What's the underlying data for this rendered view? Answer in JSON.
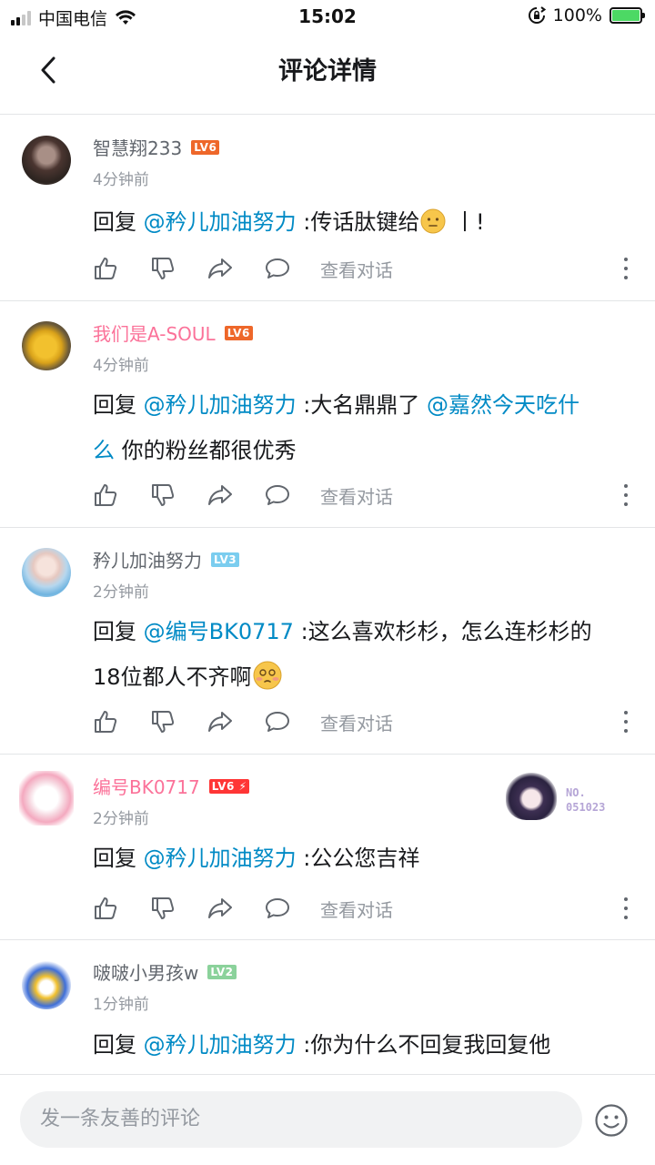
{
  "status_bar": {
    "carrier": "中国电信",
    "time": "15:02",
    "battery": "100%"
  },
  "header": {
    "title": "评论详情"
  },
  "labels": {
    "view_conversation": "查看对话"
  },
  "comments": [
    {
      "username": "智慧翔233",
      "level": "LV6",
      "time": "4分钟前",
      "reply_prefix": "回复",
      "mention": "@矜儿加油努力",
      "text": ":传话肽键给",
      "suffix": "丨!"
    },
    {
      "username": "我们是A-SOUL",
      "level": "LV6",
      "time": "4分钟前",
      "reply_prefix": "回复",
      "mention": "@矜儿加油努力",
      "text": ":大名鼎鼎了",
      "mention2_line1": "@嘉然今天吃什",
      "mention2_line2": "么",
      "text2": "你的粉丝都很优秀"
    },
    {
      "username": "矜儿加油努力",
      "level": "LV3",
      "time": "2分钟前",
      "reply_prefix": "回复",
      "mention": "@编号BK0717",
      "text": ":这么喜欢杉杉，怎么连杉杉的",
      "text2": "18位都人不齐啊"
    },
    {
      "username": "编号BK0717",
      "level": "LV6",
      "time": "2分钟前",
      "reply_prefix": "回复",
      "mention": "@矜儿加油努力",
      "text": ":公公您吉祥",
      "fan_badge_line1": "NO.",
      "fan_badge_line2": "051023"
    },
    {
      "username": "啵啵小男孩w",
      "level": "LV2",
      "time": "1分钟前",
      "reply_prefix": "回复",
      "mention": "@矜儿加油努力",
      "text": ":你为什么不回复我回复他"
    }
  ],
  "bottom_bar": {
    "placeholder": "发一条友善的评论"
  }
}
